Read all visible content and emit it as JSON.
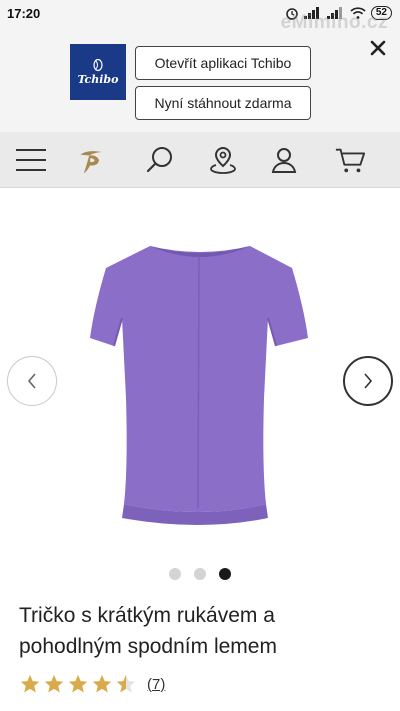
{
  "status_bar": {
    "time": "17:20",
    "battery": "52"
  },
  "watermark": "eMimino.cz",
  "app_banner": {
    "logo_text": "Tchibo",
    "open_app_label": "Otevřít aplikaci Tchibo",
    "download_label": "Nyní stáhnout zdarma"
  },
  "product": {
    "title": "Tričko s krátkým rukávem a pohodlným spodním lemem",
    "rating_value": 4.5,
    "review_count": "(7)",
    "image_count": 3,
    "active_image": 3,
    "colors": {
      "shirt": "#8a6ec7",
      "brand_blue": "#1a3a87",
      "star": "#d8aa49"
    }
  }
}
